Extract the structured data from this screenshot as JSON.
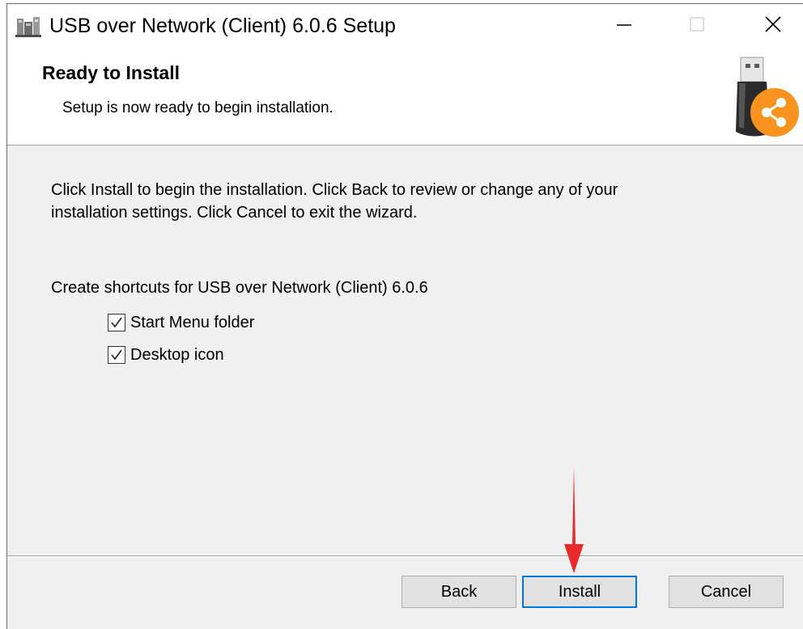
{
  "window": {
    "title": "USB over Network (Client) 6.0.6 Setup",
    "minimize_glyph": "—",
    "close_glyph": "✕"
  },
  "header": {
    "title": "Ready to Install",
    "subtitle": "Setup is now ready to begin installation."
  },
  "body": {
    "intro_line1": "Click Install to begin the installation. Click Back to review or change any of your",
    "intro_line2": "installation settings. Click Cancel to exit the wizard.",
    "shortcuts_label": "Create shortcuts for USB over Network (Client) 6.0.6",
    "options": [
      {
        "label": "Start Menu folder",
        "checked": true
      },
      {
        "label": "Desktop icon",
        "checked": true
      }
    ]
  },
  "buttons": {
    "back": "Back",
    "install": "Install",
    "cancel": "Cancel"
  },
  "colors": {
    "accent": "#0078d7",
    "logo_orange": "#f7931e",
    "annotation_arrow": "#ea2a2a"
  },
  "icons": {
    "app": "setup-installer-icon",
    "logo": "usb-share-icon",
    "minimize": "minimize-icon",
    "maximize": "maximize-icon",
    "close": "close-icon"
  }
}
